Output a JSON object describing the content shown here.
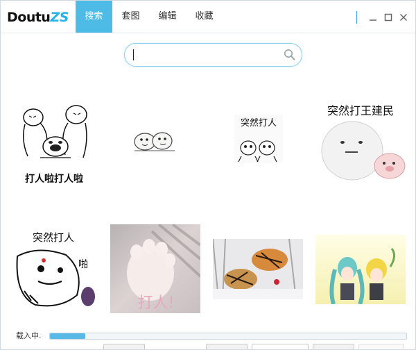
{
  "app": {
    "logo_main": "Doutu",
    "logo_accent": "ZS"
  },
  "tabs": [
    {
      "label": "搜索",
      "active": true
    },
    {
      "label": "套图",
      "active": false
    },
    {
      "label": "编辑",
      "active": false
    },
    {
      "label": "收藏",
      "active": false
    }
  ],
  "search": {
    "value": "",
    "placeholder": ""
  },
  "results": [
    {
      "caption": "打人啦打人啦",
      "icon": "fighting-panda-meme-image"
    },
    {
      "caption": "",
      "icon": "two-panda-heads-meme-image"
    },
    {
      "text_in_image": "突然打人",
      "icon": "panda-punch-meme-image"
    },
    {
      "text_in_image": "突然打王建民",
      "icon": "bear-punch-meme-image"
    },
    {
      "text_in_image": "突然打人",
      "icon": "panda-face-meme-image"
    },
    {
      "text_in_image": "打人!",
      "icon": "cat-paw-meme-image"
    },
    {
      "caption": "",
      "icon": "tiger-attack-image"
    },
    {
      "caption": "",
      "icon": "anime-characters-image"
    }
  ],
  "status": {
    "loading_text": "载入中.",
    "progress": 0.1
  },
  "colors": {
    "accent": "#4dbbe6",
    "logo_accent": "#24b3e8",
    "progress_fill": "#59b9e6"
  }
}
